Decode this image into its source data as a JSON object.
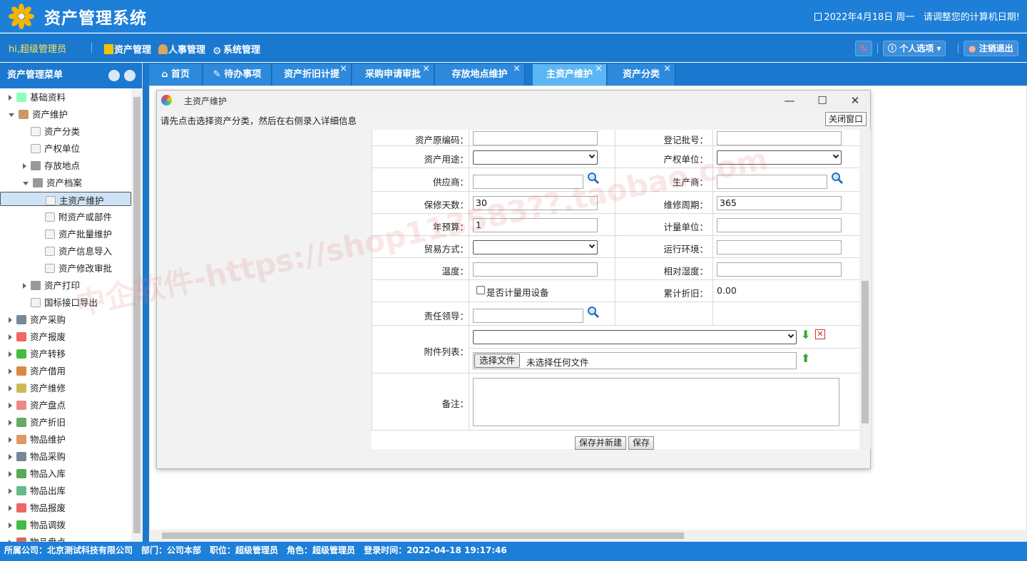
{
  "app": {
    "title": "资产管理系统",
    "date": "2022年4月18日 周一",
    "date_hint": "请调整您的计算机日期!"
  },
  "nav": {
    "greeting": "hi,超级管理员",
    "menus": [
      "资产管理",
      "人事管理",
      "系统管理"
    ],
    "personal": "个人选项",
    "logout": "注销退出"
  },
  "sidebar": {
    "title": "资产管理菜单",
    "items": [
      {
        "label": "基础资料"
      },
      {
        "label": "资产维护"
      },
      {
        "label": "资产分类"
      },
      {
        "label": "产权单位"
      },
      {
        "label": "存放地点"
      },
      {
        "label": "资产档案"
      },
      {
        "label": "主资产维护"
      },
      {
        "label": "附资产或部件"
      },
      {
        "label": "资产批量维护"
      },
      {
        "label": "资产信息导入"
      },
      {
        "label": "资产修改审批"
      },
      {
        "label": "资产打印"
      },
      {
        "label": "国标接口导出"
      },
      {
        "label": "资产采购"
      },
      {
        "label": "资产报废"
      },
      {
        "label": "资产转移"
      },
      {
        "label": "资产借用"
      },
      {
        "label": "资产维修"
      },
      {
        "label": "资产盘点"
      },
      {
        "label": "资产折旧"
      },
      {
        "label": "物品维护"
      },
      {
        "label": "物品采购"
      },
      {
        "label": "物品入库"
      },
      {
        "label": "物品出库"
      },
      {
        "label": "物品报废"
      },
      {
        "label": "物品调拨"
      },
      {
        "label": "物品盘点"
      }
    ]
  },
  "tabs": [
    {
      "label": "首页"
    },
    {
      "label": "待办事项"
    },
    {
      "label": "资产折旧计提"
    },
    {
      "label": "采购申请审批"
    },
    {
      "label": "存放地点维护"
    },
    {
      "label": "主资产维护"
    },
    {
      "label": "资产分类"
    }
  ],
  "dialog": {
    "title": "主资产维护",
    "instruction": "请先点击选择资产分类，然后在右侧录入详细信息",
    "close_label": "关闭窗口",
    "labels": {
      "orig_code": "资产原编码：",
      "reg_batch": "登记批号：",
      "usage": "资产用途：",
      "ownership": "产权单位：",
      "supplier": "供应商：",
      "manufacturer": "生产商：",
      "warranty_days": "保修天数：",
      "maint_cycle": "维修周期：",
      "annual_budget": "年预算：",
      "unit": "计量单位：",
      "trade_mode": "贸易方式：",
      "env": "运行环境：",
      "temperature": "温度：",
      "humidity": "相对湿度：",
      "metering": "是否计量用设备",
      "acc_depr": "累计折旧：",
      "leader": "责任领导：",
      "attachments": "附件列表：",
      "remarks": "备注："
    },
    "values": {
      "warranty_days": "30",
      "maint_cycle": "365",
      "annual_budget": "1",
      "acc_depr": "0.00"
    },
    "file_button": "选择文件",
    "file_status": "未选择任何文件",
    "save_new": "保存并新建",
    "save": "保存"
  },
  "watermark": "中企软件-https://shop113583??.taobao.com",
  "statusbar": {
    "company": "所属公司：北京测试科技有限公司",
    "dept": "部门：公司本部",
    "position": "职位：超级管理员",
    "role": "角色：超级管理员",
    "login": "登录时间：2022-04-18 19:17:46"
  }
}
